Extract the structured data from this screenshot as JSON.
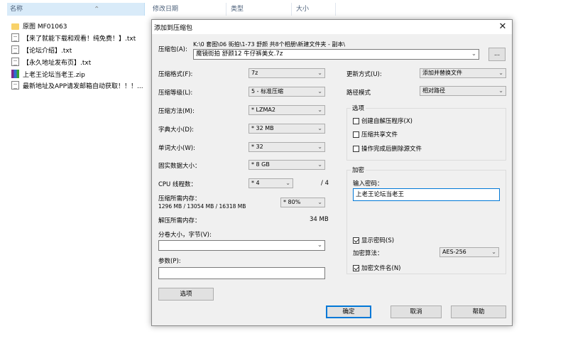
{
  "explorer": {
    "columns": {
      "name": "名称",
      "modified": "修改日期",
      "type": "类型",
      "size": "大小"
    },
    "files": [
      {
        "name": "原图 MF01063",
        "icon": "folder-icon"
      },
      {
        "name": "【来了就能下载和观看！纯免费！】.txt",
        "icon": "text-file-icon"
      },
      {
        "name": "【论坛介绍】.txt",
        "icon": "text-file-icon"
      },
      {
        "name": "【永久地址发布页】.txt",
        "icon": "text-file-icon"
      },
      {
        "name": "上老王论坛当老王.zip",
        "icon": "zip-archive-icon"
      },
      {
        "name": "最新地址及APP请发邮箱自动获取！！！...",
        "icon": "text-file-icon"
      }
    ]
  },
  "dialog": {
    "title": "添加到压缩包",
    "close": "✕",
    "archive": {
      "label": "压缩包(A):",
      "path": "K:\\0 套图\\06 街拍\\1-73 舒颜 共8个相册\\新建文件夹 - 副本\\",
      "name": "魔镜街拍 舒颜12 牛仔裤美女.7z",
      "browse": "..."
    },
    "format": {
      "label": "压缩格式(F):",
      "value": "7z"
    },
    "level": {
      "label": "压缩等级(L):",
      "value": "5 - 标准压缩"
    },
    "method": {
      "label": "压缩方法(M):",
      "value": "* LZMA2"
    },
    "dict": {
      "label": "字典大小(D):",
      "value": "* 32 MB"
    },
    "word": {
      "label": "单词大小(W):",
      "value": "* 32"
    },
    "solid": {
      "label": "固实数据大小：",
      "value": "* 8 GB"
    },
    "threads": {
      "label": "CPU 线程数：",
      "value": "* 4",
      "max": "/ 4"
    },
    "mem_compress": {
      "label": "压缩所需内存：",
      "detail": "1296 MB / 13054 MB / 16318 MB",
      "value": "* 80%"
    },
    "mem_decompress": {
      "label": "解压所需内存：",
      "value": "34 MB"
    },
    "split": {
      "label": "分卷大小，字节(V):",
      "value": ""
    },
    "params": {
      "label": "参数(P):",
      "value": ""
    },
    "options_button": "选项",
    "update": {
      "label": "更新方式(U):",
      "value": "添加并替换文件"
    },
    "pathmode": {
      "label": "路径模式",
      "value": "相对路径"
    },
    "options_group": {
      "title": "选项",
      "sfx": {
        "label": "创建自解压程序(X)",
        "checked": false
      },
      "shared": {
        "label": "压缩共享文件",
        "checked": false
      },
      "delete": {
        "label": "操作完成后删除源文件",
        "checked": false
      }
    },
    "encryption": {
      "title": "加密",
      "password_label": "输入密码：",
      "password": "上老王论坛当老王",
      "show": {
        "label": "显示密码(S)",
        "checked": true
      },
      "method_label": "加密算法：",
      "method": "AES-256",
      "names": {
        "label": "加密文件名(N)",
        "checked": true
      }
    },
    "buttons": {
      "ok": "确定",
      "cancel": "取消",
      "help": "帮助"
    }
  }
}
